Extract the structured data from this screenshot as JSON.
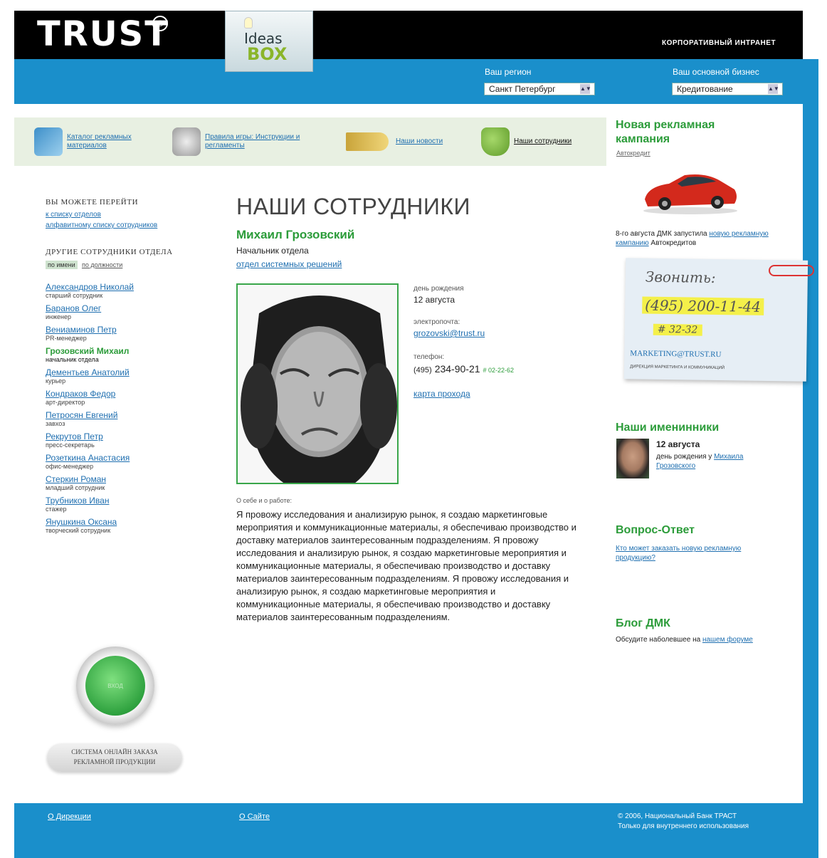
{
  "header": {
    "logo_text": "TRUST",
    "logo_reg": "®",
    "ideas_word": "Ideas",
    "box_word": "BOX",
    "corp_intranet": "КОРПОРАТИВНЫЙ ИНТРАНЕТ",
    "region_label": "Ваш регион",
    "region_value": "Санкт Петербург",
    "business_label": "Ваш основной бизнес",
    "business_value": "Кредитование"
  },
  "menu": [
    {
      "label": "Каталог рекламных материалов"
    },
    {
      "label": "Правила игры: Инструкции и регламенты"
    },
    {
      "label": "Наши новости"
    },
    {
      "label": "Наши сотрудники"
    }
  ],
  "left": {
    "goto_heading": "ВЫ МОЖЕТЕ ПЕРЕЙТИ",
    "goto_link1": "к списку отделов",
    "goto_link2": "алфавитному списку сотрудников",
    "others_heading": "ДРУГИЕ СОТРУДНИКИ ОТДЕЛА",
    "tab_name": "по имени",
    "tab_position": "по должности",
    "employees": [
      {
        "name": "Александров Николай",
        "role": "старший сотрудник"
      },
      {
        "name": "Баранов Олег",
        "role": "инженер"
      },
      {
        "name": "Вениаминов Петр",
        "role": "PR-менеджер"
      },
      {
        "name": "Грозовский Михаил",
        "role": "начальник отдела"
      },
      {
        "name": "Дементьев Анатолий",
        "role": "курьер"
      },
      {
        "name": "Кондраков Федор",
        "role": "арт-директор"
      },
      {
        "name": "Петросян Евгений",
        "role": "завхоз"
      },
      {
        "name": "Рекрутов Петр",
        "role": "пресс-секретарь"
      },
      {
        "name": "Розеткина Анастасия",
        "role": "офис-менеджер"
      },
      {
        "name": "Стеркин Роман",
        "role": "младший сотрудник"
      },
      {
        "name": "Трубников Иван",
        "role": "стажер"
      },
      {
        "name": "Янушкина Оксана",
        "role": "творческий сотрудник"
      }
    ],
    "button_label": "ВХОД",
    "order_line1": "СИСТЕМА ОНЛАЙН ЗАКАЗА",
    "order_line2": "РЕКЛАМНОЙ ПРОДУКЦИИ"
  },
  "main": {
    "title": "НАШИ СОТРУДНИКИ",
    "person_name": "Михаил Грозовский",
    "person_position": "Начальник отдела",
    "person_department": "отдел системных решений",
    "birthday_label": "день рождения",
    "birthday_value": "12 августа",
    "email_label": "электропочта:",
    "email_value": "grozovski@trust.ru",
    "phone_label": "телефон:",
    "phone_code": "(495)",
    "phone_number": "234-90-21",
    "phone_ext": "# 02-22-62",
    "map_link": "карта прохода",
    "about_label": "О себе и о работе:",
    "about_text": "Я провожу исследования и анализирую рынок, я создаю маркетинговые мероприятия и коммуникационные материалы, я обеспечиваю производство и доставку материалов заинтересованным подразделениям. Я провожу исследования и анализирую рынок, я создаю маркетинговые мероприятия и коммуникационные материалы, я обеспечиваю производство и доставку материалов заинтересованным подразделениям. Я провожу исследования и анализирую рынок, я создаю маркетинговые мероприятия и коммуникационные материалы, я обеспечиваю производство и доставку материалов заинтересованным подразделениям."
  },
  "right": {
    "campaign_title": "Новая рекламная кампания",
    "campaign_sub": "Автокредит",
    "campaign_text_before": "8-го августа ДМК запустила ",
    "campaign_link": "новую рекламную кампанию",
    "campaign_text_after": " Автокредитов",
    "note_title": "Звонить:",
    "note_phone": "(495) 200-11-44",
    "note_ext": "# 32-32",
    "note_email": "MARKETING@TRUST.RU",
    "note_dept": "ДИРЕКЦИЯ МАРКЕТИНГА И КОММУНИКАЦИЙ",
    "bday_title": "Наши именинники",
    "bday_date": "12 августа",
    "bday_text": "день рождения у ",
    "bday_link": "Михаила Грозовского",
    "qa_title": "Вопрос-Ответ",
    "qa_link": "Кто может заказать новую рекламную продукцию?",
    "blog_title": "Блог ДМК",
    "blog_text": "Обсудите наболевшее на ",
    "blog_link": "нашем форуме"
  },
  "footer": {
    "link1": "О Дирекции",
    "link2": "О Сайте",
    "copyright": "© 2006, Национальный Банк ТРАСТ",
    "internal": "Только для внутреннего использования"
  }
}
